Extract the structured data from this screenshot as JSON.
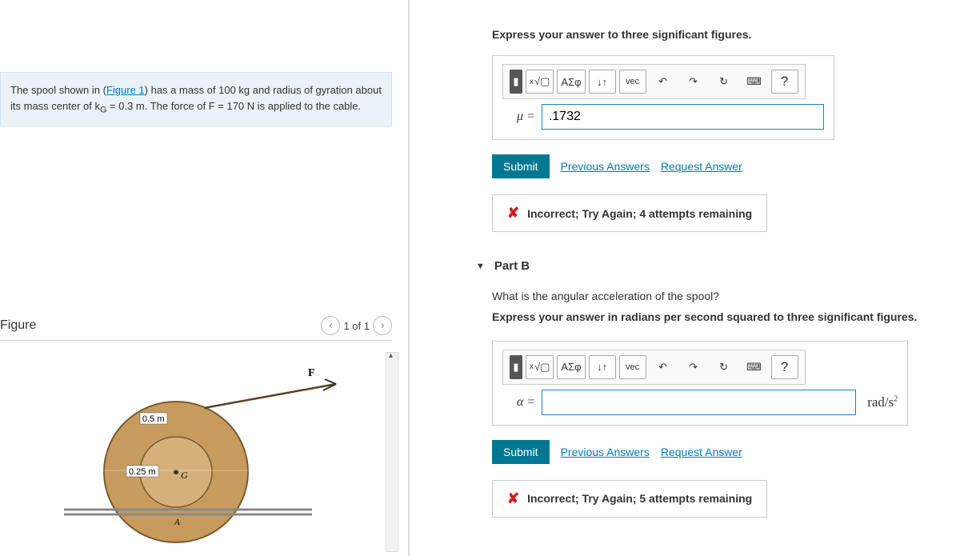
{
  "problem": {
    "pre": "The spool shown in (",
    "figure_link": "Figure 1",
    "post": ") has a mass of 100 kg and radius of gyration about its mass center of k",
    "sub": "G",
    "post2": " = 0.3 m. The force of F = 170 N is applied to the cable."
  },
  "figure": {
    "title": "Figure",
    "pager": "1 of 1",
    "label_r1": "0.5 m",
    "label_r2": "0.25 m",
    "label_G": "G",
    "label_A": "A",
    "label_F": "F"
  },
  "partA": {
    "instruction": "Express your answer to three significant figures.",
    "var": "μ =",
    "value": ".1732",
    "submit": "Submit",
    "prev": "Previous Answers",
    "req": "Request Answer",
    "feedback": "Incorrect; Try Again; 4 attempts remaining"
  },
  "partB": {
    "header": "Part B",
    "question": "What is the angular acceleration of the spool?",
    "instruction": "Express your answer in radians per second squared to three significant figures.",
    "var": "α =",
    "value": "",
    "unit": "rad/s",
    "submit": "Submit",
    "prev": "Previous Answers",
    "req": "Request Answer",
    "feedback": "Incorrect; Try Again; 5 attempts remaining"
  },
  "toolbar": {
    "sqrt": "√▢",
    "greek": "ΑΣφ",
    "subsup": "↓↑",
    "vec": "vec",
    "undo": "↶",
    "redo": "↷",
    "reset": "↻",
    "kbd": "⌨",
    "help": "?"
  }
}
